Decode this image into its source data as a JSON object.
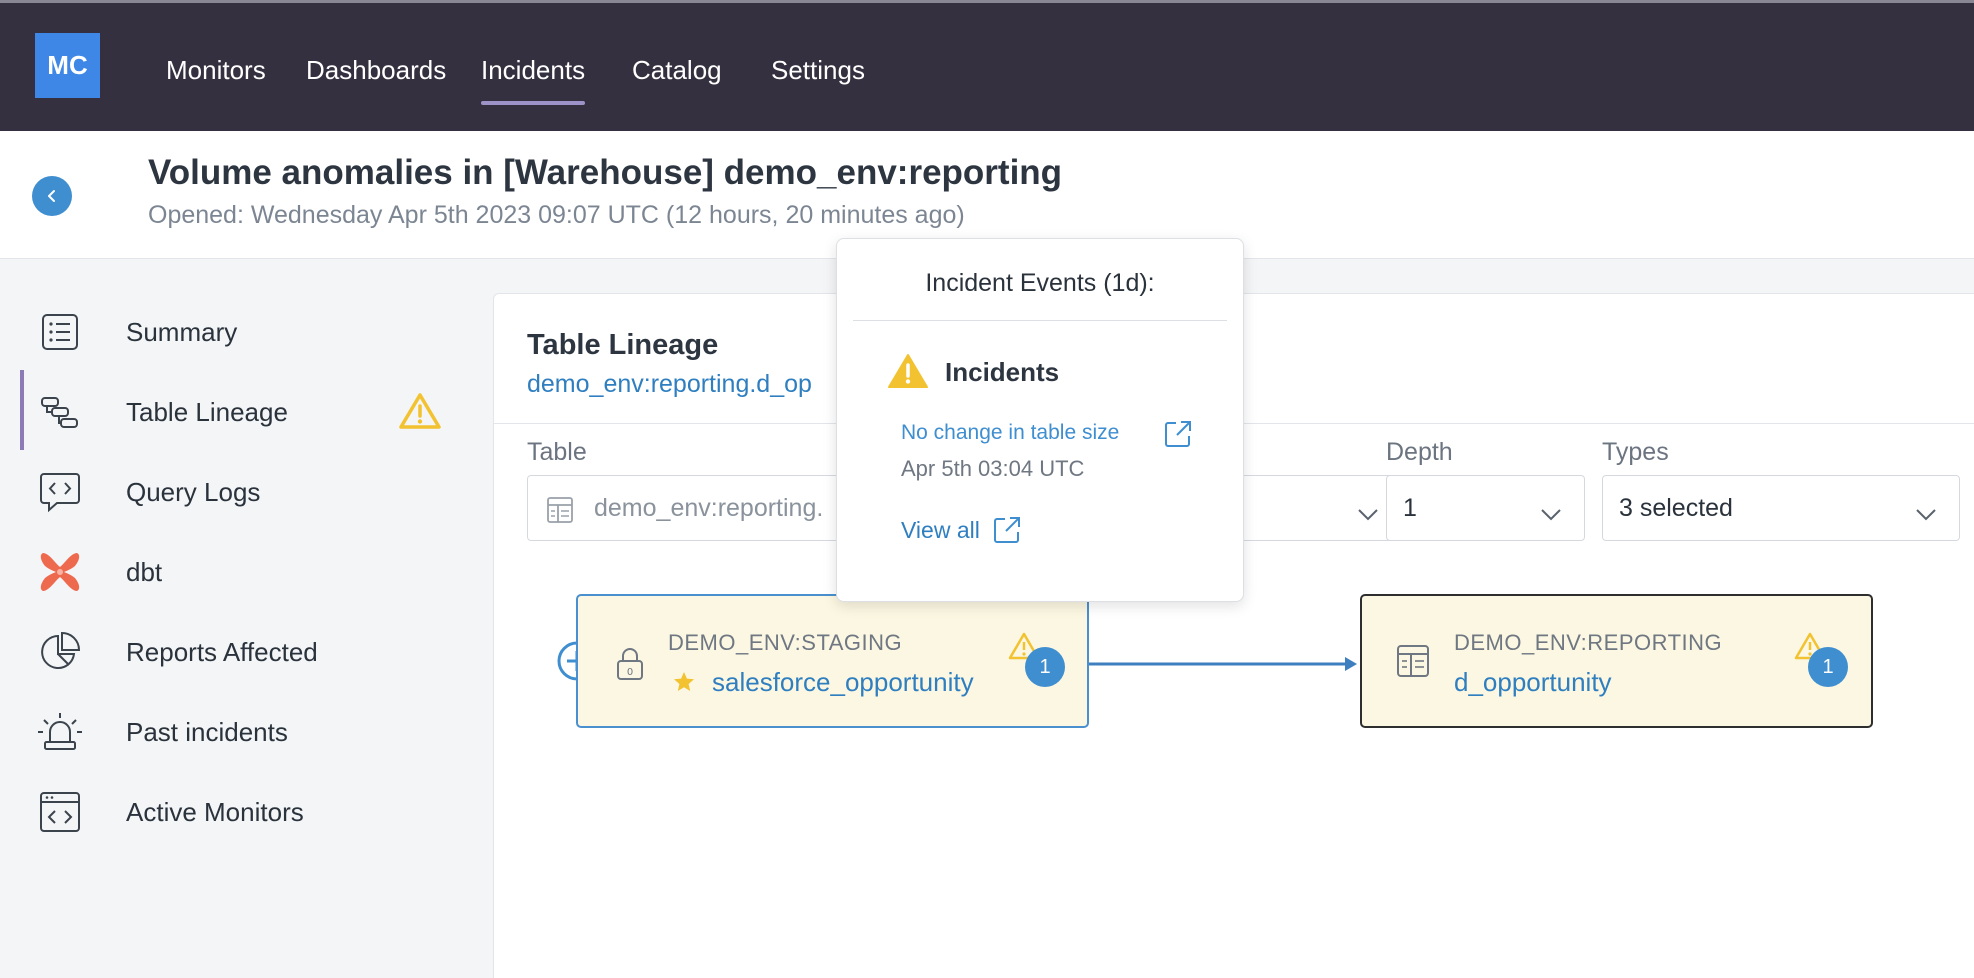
{
  "app": {
    "logo_text": "MC"
  },
  "nav": {
    "items": [
      "Monitors",
      "Dashboards",
      "Incidents",
      "Catalog",
      "Settings"
    ],
    "active": "Incidents"
  },
  "header": {
    "title": "Volume anomalies in [Warehouse] demo_env:reporting",
    "subtitle": "Opened: Wednesday Apr 5th 2023 09:07 UTC (12 hours, 20 minutes ago)"
  },
  "sidebar": {
    "items": [
      {
        "label": "Summary",
        "icon": "list-icon"
      },
      {
        "label": "Table Lineage",
        "icon": "lineage-icon",
        "active": true,
        "warning": true
      },
      {
        "label": "Query Logs",
        "icon": "code-bubble-icon"
      },
      {
        "label": "dbt",
        "icon": "dbt-icon"
      },
      {
        "label": "Reports Affected",
        "icon": "pie-chart-icon"
      },
      {
        "label": "Past incidents",
        "icon": "siren-icon"
      },
      {
        "label": "Active Monitors",
        "icon": "code-window-icon"
      }
    ]
  },
  "panel": {
    "title": "Table Lineage",
    "link": "demo_env:reporting.d_op",
    "filters": {
      "table_label": "Table",
      "table_value": "demo_env:reporting.",
      "depth_label": "Depth",
      "depth_value": "1",
      "types_label": "Types",
      "types_value": "3 selected"
    },
    "nodes": [
      {
        "kind": "DEMO_ENV:STAGING",
        "name": "salesforce_opportunity",
        "badge": "1",
        "starred": true
      },
      {
        "kind": "DEMO_ENV:REPORTING",
        "name": "d_opportunity",
        "badge": "1",
        "starred": false
      }
    ]
  },
  "popover": {
    "title": "Incident Events (1d):",
    "section": "Incidents",
    "event_link": "No change in table size",
    "event_date": "Apr 5th 03:04 UTC",
    "view_all": "View all"
  },
  "colors": {
    "nav_bg": "#34303f",
    "accent_blue": "#3e8ed0",
    "warning_yellow": "#f2c230",
    "node_bg": "#fbf7e2",
    "dbt_orange": "#ee6a4f"
  }
}
